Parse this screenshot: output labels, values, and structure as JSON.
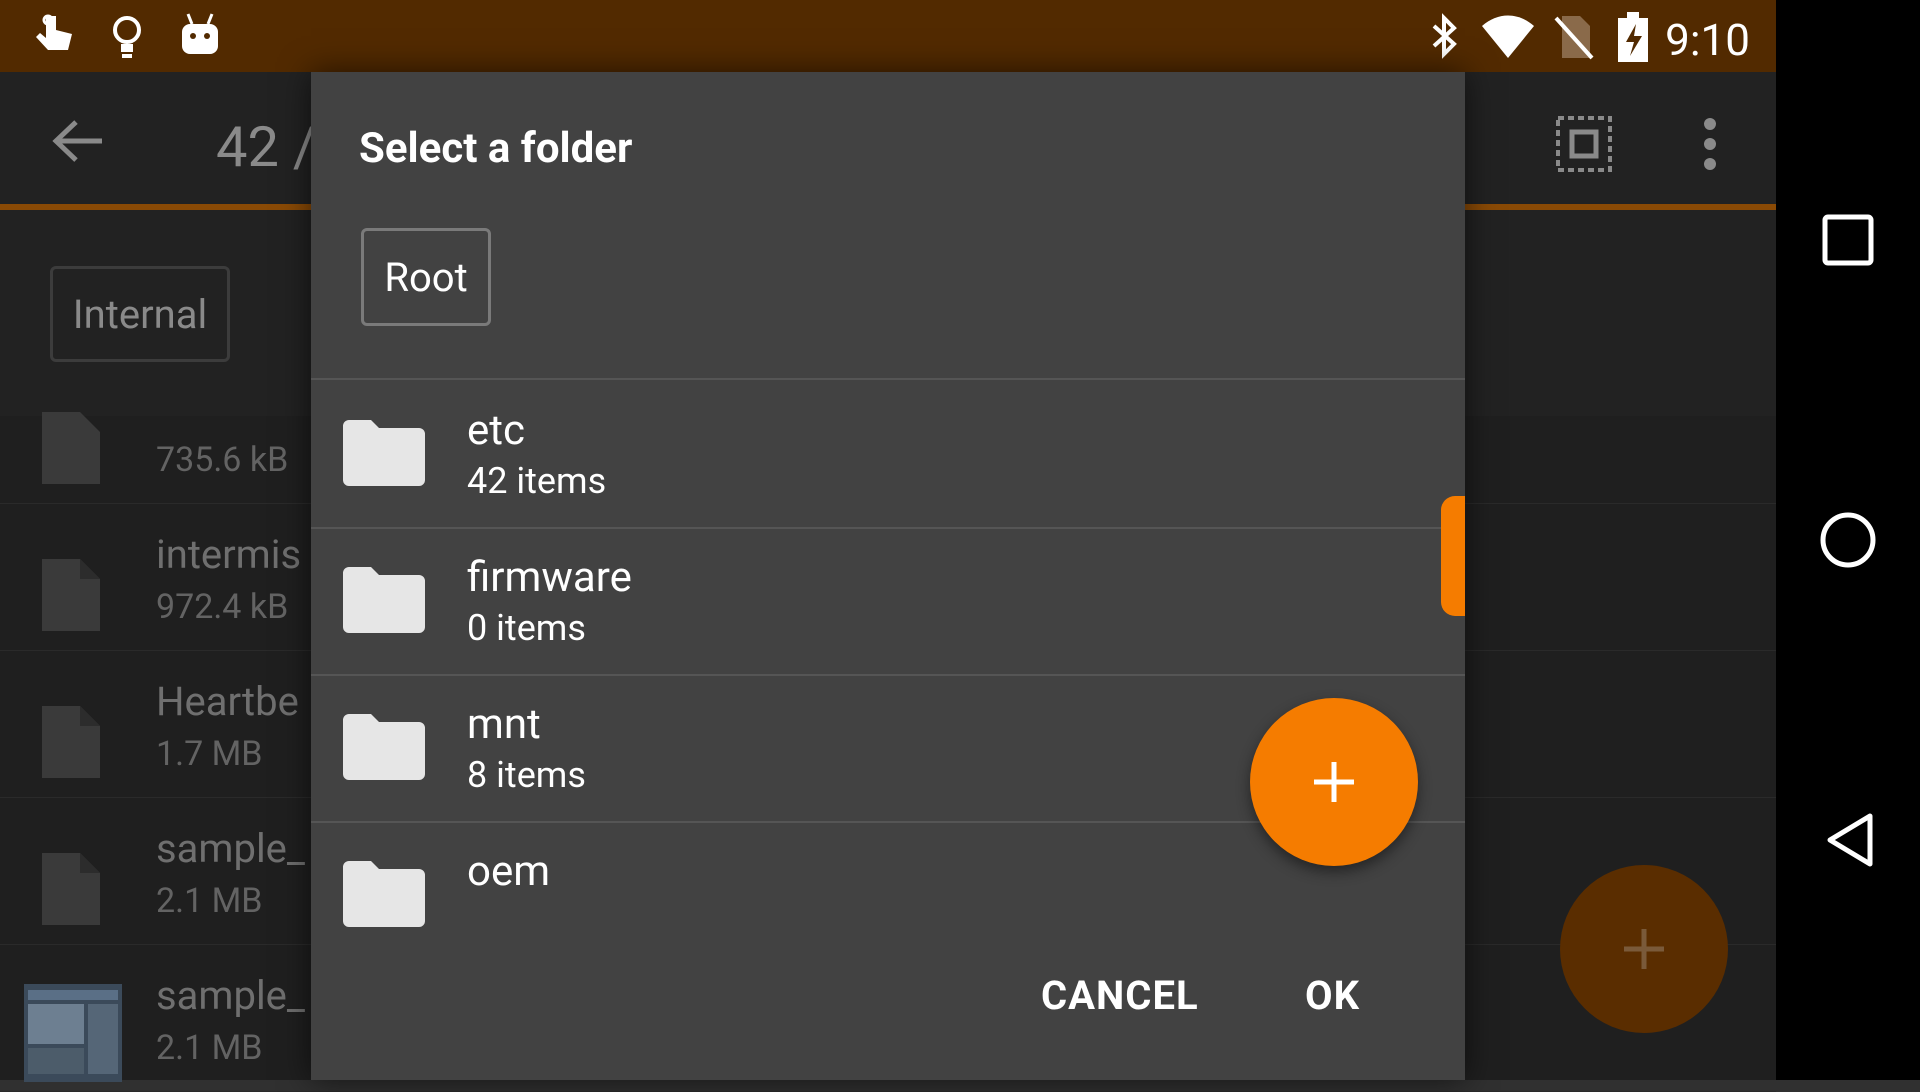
{
  "status_bar": {
    "time": "9:10"
  },
  "app": {
    "title": "42 / ...",
    "storage_chip": "Internal",
    "files": [
      {
        "name": "",
        "size": "735.6 kB"
      },
      {
        "name": "intermis",
        "size": "972.4 kB"
      },
      {
        "name": "Heartbe",
        "size": "1.7 MB"
      },
      {
        "name": "sample_",
        "size": "2.1 MB"
      },
      {
        "name": "sample_",
        "size": "2.1 MB"
      }
    ]
  },
  "dialog": {
    "title": "Select a folder",
    "breadcrumb": "Root",
    "folders": [
      {
        "name": "etc",
        "count": "42 items"
      },
      {
        "name": "firmware",
        "count": "0 items"
      },
      {
        "name": "mnt",
        "count": "8 items"
      },
      {
        "name": "oem",
        "count": ""
      }
    ],
    "cancel_label": "CANCEL",
    "ok_label": "OK"
  },
  "colors": {
    "accent": "#f57c00",
    "status_bar": "#522a00",
    "dialog_bg": "#424242"
  },
  "icons": {
    "status_left": [
      "touch-icon",
      "lightbulb-icon",
      "android-icon"
    ],
    "status_right": [
      "bluetooth-icon",
      "wifi-icon",
      "no-sim-icon",
      "battery-charging-icon"
    ],
    "nav": [
      "recents-icon",
      "home-icon",
      "back-icon"
    ],
    "toolbar": [
      "back-arrow-icon",
      "select-all-icon",
      "more-vert-icon"
    ]
  }
}
